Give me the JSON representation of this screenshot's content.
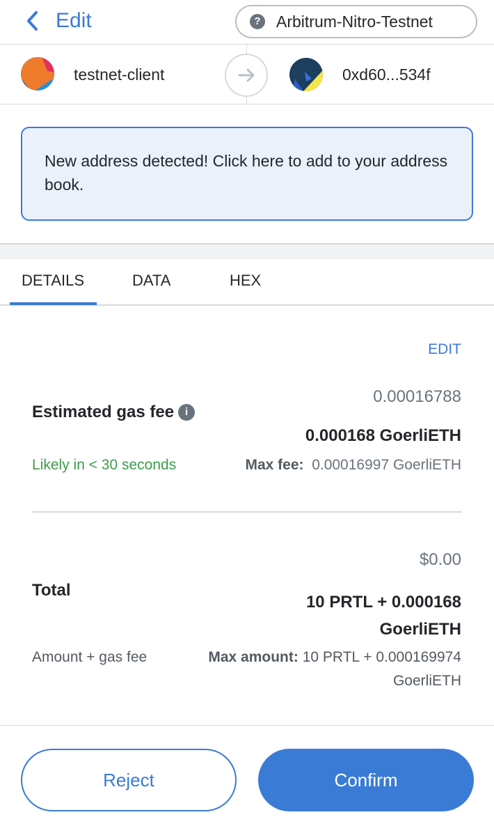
{
  "header": {
    "back_label": "Edit",
    "network_icon": "?",
    "network_name": "Arbitrum-Nitro-Testnet"
  },
  "from_to": {
    "sender_name": "testnet-client",
    "recipient_address": "0xd60...534f",
    "arrow_icon": "arrow-right-icon"
  },
  "banner": {
    "text": "New address detected! Click here to add to your address book."
  },
  "tabs": [
    {
      "label": "DETAILS",
      "active": true
    },
    {
      "label": "DATA",
      "active": false
    },
    {
      "label": "HEX",
      "active": false
    }
  ],
  "gas": {
    "edit_label": "EDIT",
    "fiat_value": "0.00016788",
    "label": "Estimated gas fee",
    "info_icon": "i",
    "amount": "0.000168 GoerliETH",
    "likely_text": "Likely in < 30 seconds",
    "max_fee_label": "Max fee:",
    "max_fee_value": "0.00016997 GoerliETH"
  },
  "total": {
    "fiat_value": "$0.00",
    "label": "Total",
    "amount_line1": "10 PRTL + 0.000168",
    "amount_line2": "GoerliETH",
    "sub_label": "Amount + gas fee",
    "max_amount_label": "Max amount:",
    "max_amount_value": "10 PRTL + 0.000169974 GoerliETH"
  },
  "footer": {
    "reject_label": "Reject",
    "confirm_label": "Confirm"
  },
  "colors": {
    "accent": "#3a7bd5",
    "success": "#3d9c49",
    "banner_bg": "#eaf1fb"
  }
}
